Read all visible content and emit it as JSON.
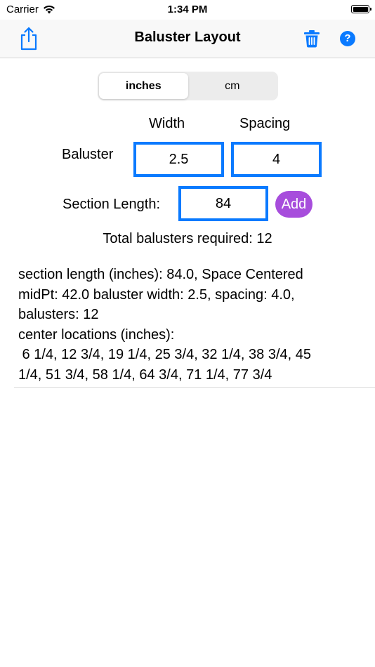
{
  "status_bar": {
    "carrier": "Carrier",
    "time": "1:34 PM",
    "battery_level": 1.0
  },
  "nav": {
    "title": "Baluster Layout",
    "left_icon": "share-icon",
    "right_icons": [
      "trash-icon",
      "help-icon"
    ],
    "help_label": "?",
    "accent_color": "#0a7aff"
  },
  "units": {
    "options": [
      "inches",
      "cm"
    ],
    "selected": "inches"
  },
  "form": {
    "width_label": "Width",
    "spacing_label": "Spacing",
    "baluster_label": "Baluster",
    "width_value": "2.5",
    "spacing_value": "4",
    "section_length_label": "Section Length:",
    "section_length_value": "84",
    "add_label": "Add",
    "add_color": "#a74ddc"
  },
  "total_text": "Total balusters required: 12",
  "results": {
    "lines": [
      "section length (inches): 84.0, Space Centered",
      "midPt: 42.0 baluster width: 2.5, spacing: 4.0,",
      "balusters: 12",
      "center locations (inches):",
      " 6 1/4, 12 3/4, 19 1/4, 25 3/4, 32 1/4, 38 3/4, 45",
      "1/4, 51 3/4, 58 1/4, 64 3/4, 71 1/4, 77 3/4"
    ]
  }
}
